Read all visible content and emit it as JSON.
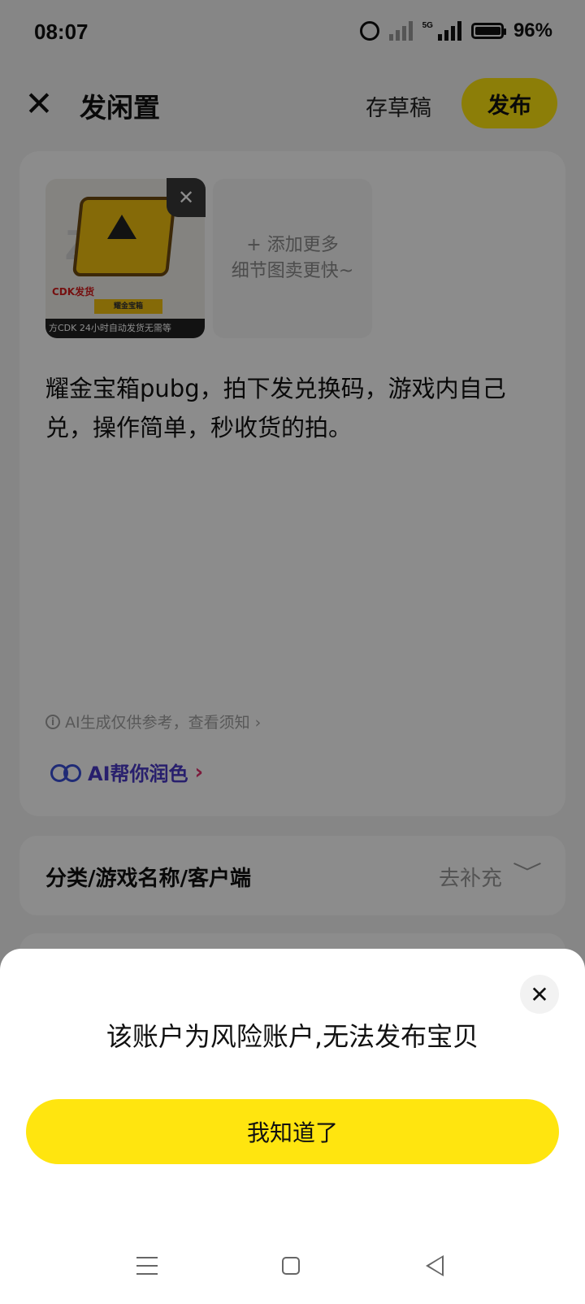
{
  "status_bar": {
    "time": "08:07",
    "network": "5G",
    "battery": "96%"
  },
  "header": {
    "title": "发闲置",
    "draft": "存草稿",
    "publish": "发布"
  },
  "images": {
    "thumb_watermark": "Zo",
    "thumb_badge": "CDK发货",
    "thumb_tag": "耀金宝箱",
    "thumb_footer": "方CDK  24小时自动发货无需等",
    "add_more_line1": "+ 添加更多",
    "add_more_line2": "细节图卖更快~"
  },
  "description": "耀金宝箱pubg，拍下发兑换码，游戏内自己兑，操作简单，秒收货的拍。",
  "ai": {
    "note": "AI生成仅供参考，查看须知 ›",
    "polish_label": "AI帮你润色",
    "polish_chevron": "›"
  },
  "category": {
    "label": "分类/游戏名称/客户端",
    "value": "去补充",
    "chevron": "﹀"
  },
  "dialog": {
    "close": "✕",
    "message": "该账户为风险账户,无法发布宝贝",
    "confirm": "我知道了"
  },
  "colors": {
    "accent": "#ffe50f",
    "ai_blue": "#3a4fd8",
    "ai_pink": "#e2326e"
  }
}
